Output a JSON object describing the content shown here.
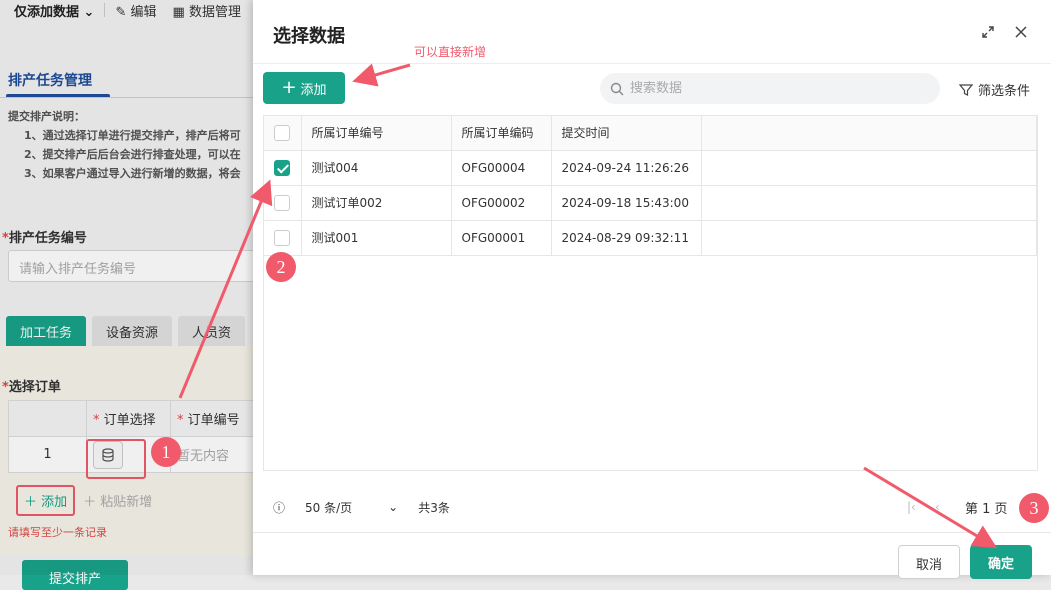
{
  "background": {
    "toolbar": {
      "dropdown_label": "仅添加数据",
      "edit_label": "编辑",
      "data_label": "数据管理"
    },
    "section_title": "排产任务管理",
    "notes": {
      "title": "提交排产说明：",
      "items": [
        "1、通过选择订单进行提交排产，排产后将可",
        "2、提交排产后后台会进行排查处理，可以在",
        "3、如果客户通过导入进行新增的数据，将会"
      ]
    },
    "task_no": {
      "label": "排产任务编号",
      "placeholder": "请输入排产任务编号"
    },
    "tabs": [
      "加工任务",
      "设备资源",
      "人员资"
    ],
    "order_section": {
      "label": "选择订单",
      "col_select": "订单选择",
      "col_no": "订单编号",
      "row_index": "1",
      "empty_text": "暂无内容",
      "add_label": "添加",
      "paste_label": "粘贴新增",
      "error_text": "请填写至少一条记录"
    },
    "submit_label": "提交排产"
  },
  "dialog": {
    "title": "选择数据",
    "hint": "可以直接新增",
    "add_label": "添加",
    "search_placeholder": "搜索数据",
    "filter_label": "筛选条件",
    "columns": [
      "所属订单编号",
      "所属订单编码",
      "提交时间"
    ],
    "rows": [
      {
        "name": "测试004",
        "code": "OFG00004",
        "time": "2024-09-24 11:26:26",
        "checked": true
      },
      {
        "name": "测试订单002",
        "code": "OFG00002",
        "time": "2024-09-18 15:43:00",
        "checked": false
      },
      {
        "name": "测试001",
        "code": "OFG00001",
        "time": "2024-08-29 09:32:11",
        "checked": false
      }
    ],
    "pager": {
      "page_size": "50 条/页",
      "total": "共3条",
      "page": "第 1 页"
    },
    "cancel_label": "取消",
    "ok_label": "确定"
  },
  "badges": [
    "1",
    "2",
    "3"
  ],
  "colors": {
    "accent": "#19a28a",
    "annotation": "#f05a6b"
  }
}
